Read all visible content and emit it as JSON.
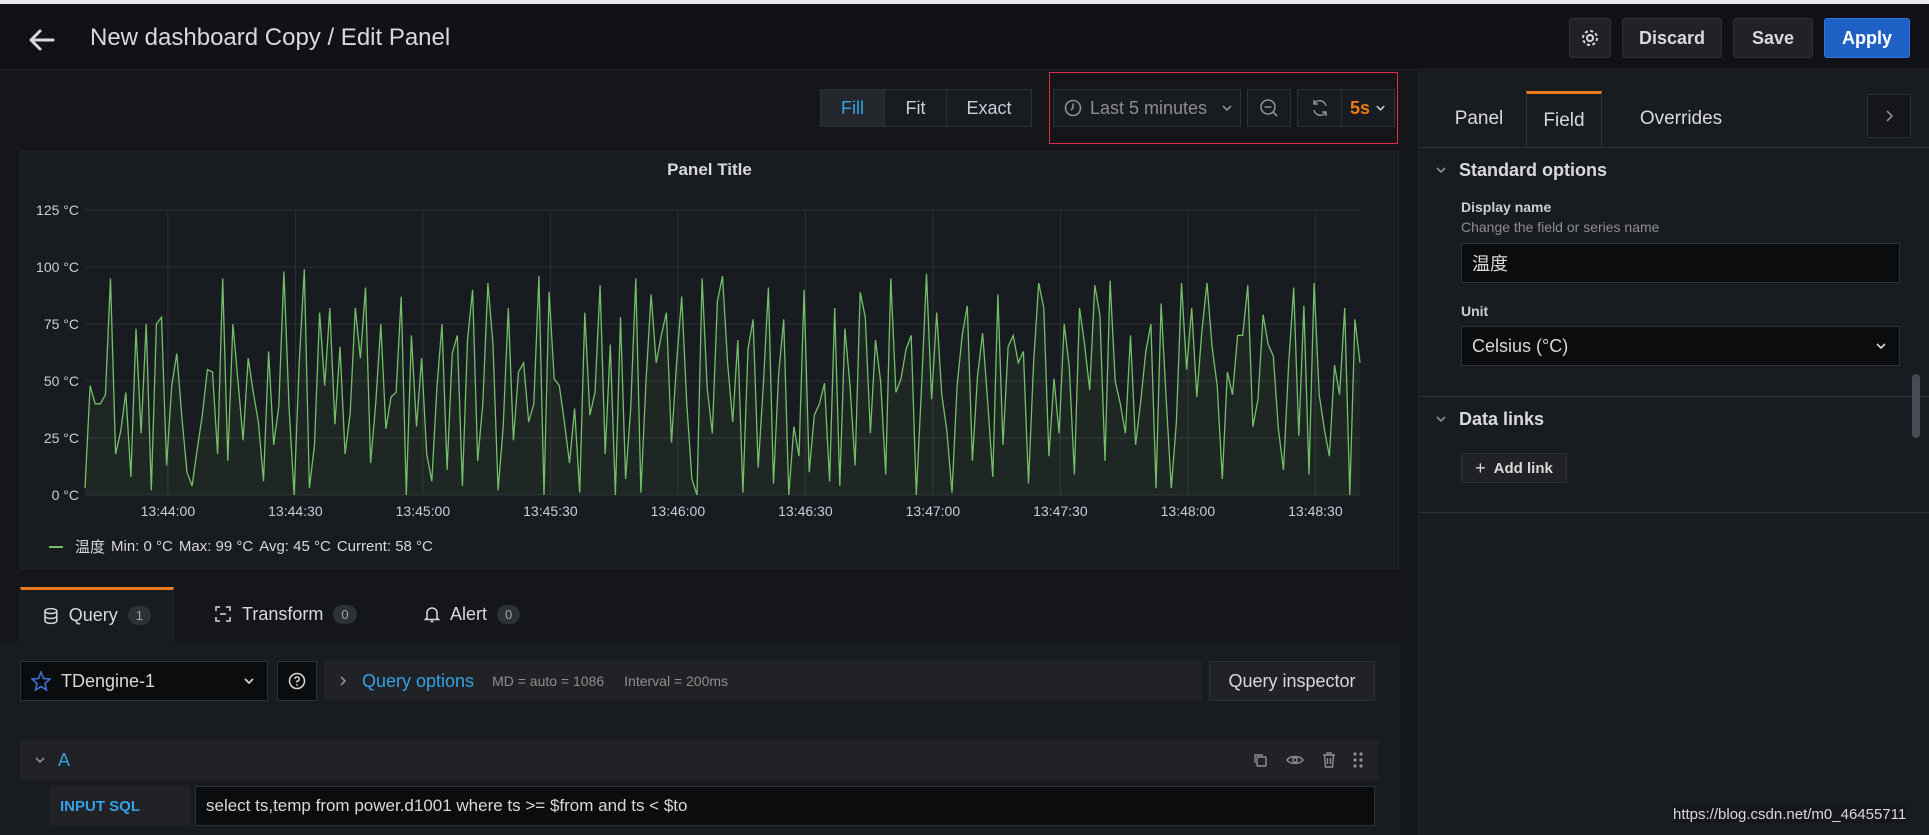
{
  "header": {
    "title": "New dashboard Copy / Edit Panel",
    "discard_label": "Discard",
    "save_label": "Save",
    "apply_label": "Apply"
  },
  "toolbar": {
    "view_modes": [
      "Fill",
      "Fit",
      "Exact"
    ],
    "active_view_mode": "Fill",
    "time_range": "Last 5 minutes",
    "refresh_interval": "5s"
  },
  "panel": {
    "title": "Panel Title",
    "legend": {
      "series": "温度",
      "min": "Min: 0 °C",
      "max": "Max: 99 °C",
      "avg": "Avg: 45 °C",
      "current": "Current: 58 °C"
    }
  },
  "chart_data": {
    "type": "line",
    "title": "Panel Title",
    "ylim": [
      0,
      125
    ],
    "y_ticks": [
      "0 °C",
      "25 °C",
      "50 °C",
      "75 °C",
      "100 °C",
      "125 °C"
    ],
    "x_ticks": [
      "13:44:00",
      "13:44:30",
      "13:45:00",
      "13:45:30",
      "13:46:00",
      "13:46:30",
      "13:47:00",
      "13:47:30",
      "13:48:00",
      "13:48:30"
    ],
    "grid": true,
    "legend": "bottom-left",
    "colors": {
      "series": "#73bf69"
    },
    "series": [
      {
        "name": "温度",
        "values": [
          3,
          48,
          40,
          40,
          44,
          95,
          18,
          28,
          45,
          8,
          73,
          27,
          75,
          2,
          75,
          78,
          13,
          48,
          62,
          34,
          10,
          4,
          20,
          35,
          55,
          54,
          18,
          95,
          15,
          75,
          50,
          24,
          60,
          45,
          32,
          6,
          63,
          22,
          39,
          98,
          39,
          0,
          58,
          99,
          3,
          22,
          80,
          48,
          82,
          31,
          65,
          18,
          36,
          82,
          60,
          91,
          14,
          40,
          75,
          29,
          43,
          45,
          87,
          0,
          70,
          30,
          60,
          18,
          6,
          47,
          75,
          11,
          62,
          70,
          4,
          68,
          90,
          15,
          40,
          93,
          66,
          2,
          30,
          82,
          24,
          54,
          58,
          32,
          40,
          96,
          0,
          89,
          51,
          48,
          32,
          14,
          38,
          1,
          80,
          35,
          45,
          92,
          18,
          66,
          0,
          78,
          7,
          38,
          95,
          1,
          50,
          88,
          58,
          70,
          80,
          23,
          58,
          87,
          40,
          7,
          0,
          95,
          47,
          27,
          85,
          96,
          58,
          32,
          68,
          1,
          64,
          77,
          12,
          48,
          91,
          5,
          53,
          77,
          0,
          30,
          17,
          90,
          10,
          35,
          40,
          49,
          6,
          82,
          4,
          73,
          48,
          13,
          89,
          78,
          27,
          68,
          50,
          9,
          95,
          45,
          51,
          64,
          70,
          0,
          46,
          97,
          42,
          80,
          44,
          28,
          1,
          48,
          70,
          83,
          15,
          52,
          71,
          41,
          8,
          88,
          22,
          65,
          70,
          58,
          63,
          5,
          58,
          93,
          82,
          17,
          51,
          27,
          75,
          56,
          9,
          82,
          66,
          46,
          92,
          79,
          15,
          94,
          50,
          40,
          27,
          70,
          22,
          41,
          63,
          75,
          3,
          84,
          42,
          3,
          32,
          93,
          55,
          82,
          43,
          72,
          93,
          65,
          48,
          7,
          54,
          44,
          70,
          70,
          92,
          30,
          42,
          79,
          66,
          61,
          29,
          11,
          57,
          91,
          26,
          83,
          9,
          93,
          44,
          29,
          17,
          57,
          44,
          82,
          0,
          77,
          58
        ]
      }
    ]
  },
  "query_tabs": [
    {
      "label": "Query",
      "count": "1"
    },
    {
      "label": "Transform",
      "count": "0"
    },
    {
      "label": "Alert",
      "count": "0"
    }
  ],
  "query": {
    "datasource": "TDengine-1",
    "options_label": "Query options",
    "options_md": "MD = auto = 1086",
    "options_interval": "Interval = 200ms",
    "inspector_label": "Query inspector",
    "ref_id": "A",
    "sql_label": "INPUT SQL",
    "sql_value": "select  ts,temp from power.d1001 where ts >= $from and ts < $to"
  },
  "right": {
    "tabs": [
      "Panel",
      "Field",
      "Overrides"
    ],
    "active_tab": "Field",
    "standard_options": "Standard options",
    "display_name_label": "Display name",
    "display_name_desc": "Change the field or series name",
    "display_name_value": "温度",
    "unit_label": "Unit",
    "unit_value": "Celsius (°C)",
    "data_links": "Data links",
    "add_link": "Add link"
  },
  "watermark": "https://blog.csdn.net/m0_46455711"
}
